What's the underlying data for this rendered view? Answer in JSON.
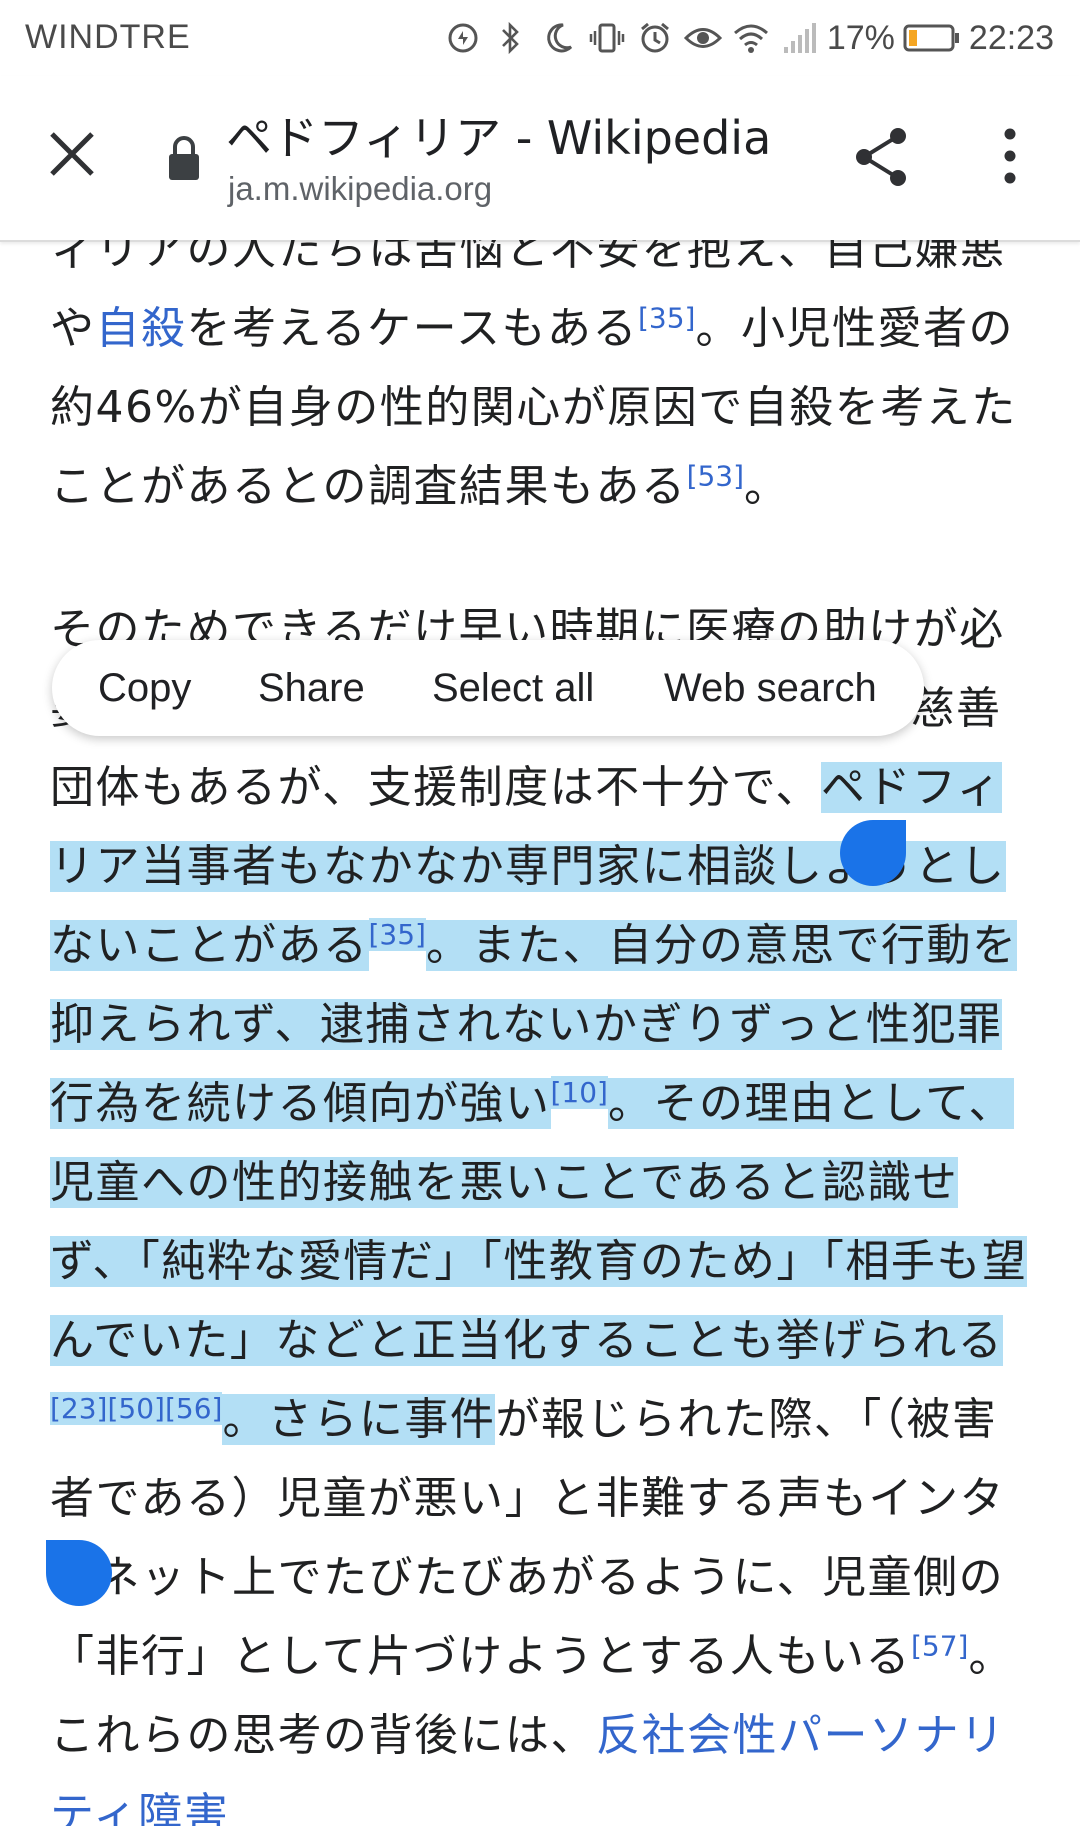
{
  "status_bar": {
    "carrier": "WINDTRE",
    "battery": "17%",
    "time": "22:23"
  },
  "toolbar": {
    "title": "ペドフィリア - Wikipedia",
    "domain": "ja.m.wikipedia.org",
    "icons": [
      "close-icon",
      "lock-icon",
      "share-icon",
      "more-vert-icon"
    ]
  },
  "article": {
    "p1": {
      "t1": "ィリアの人たちは苦悩と不安を抱え、自己嫌悪や",
      "link1": "自殺",
      "t2": "を考えるケースもある",
      "ref1": "[35]",
      "t3": "。小児性愛者の約46%が自身の性的関心が原因で自殺を考えたことがあるとの調査結果もある",
      "ref2": "[53]",
      "t4": "。"
    },
    "p2": {
      "t1": "そのためできるだけ早い時期に医療の助けが必要とされ、アメリカでは支援を行っている慈善団体もあるが、支援制度は不十分で、",
      "h1": "ペドフィリア当事者もなかなか専門家に相談しようとしないことがある",
      "ref1": "[35]",
      "h2": "。また、自分の意思で行動を抑えられず、逮捕されないかぎりずっと性犯罪行為を続ける傾向が強い",
      "ref2": "[10]",
      "h3": "。その理由として、児童への性的接触を悪いことであると認識せず、「純粋な愛情だ」「性教育のため」「相手も望んでいた」などと正当化することも挙げられる",
      "ref3": "[23][50][56]",
      "h4": "。さらに事件",
      "t2": "が報じられた際、「（被害者である）児童が悪い」と非難する声もインターネット上でたびたびあがるように、児童側の「非行」として片づけようとする人もいる",
      "ref4": "[57]",
      "t3": "。これらの思考の背後には、",
      "link1": "反社会性パーソナリティ障害"
    }
  },
  "context_menu": {
    "copy": "Copy",
    "share": "Share",
    "select_all": "Select all",
    "web_search": "Web search"
  }
}
